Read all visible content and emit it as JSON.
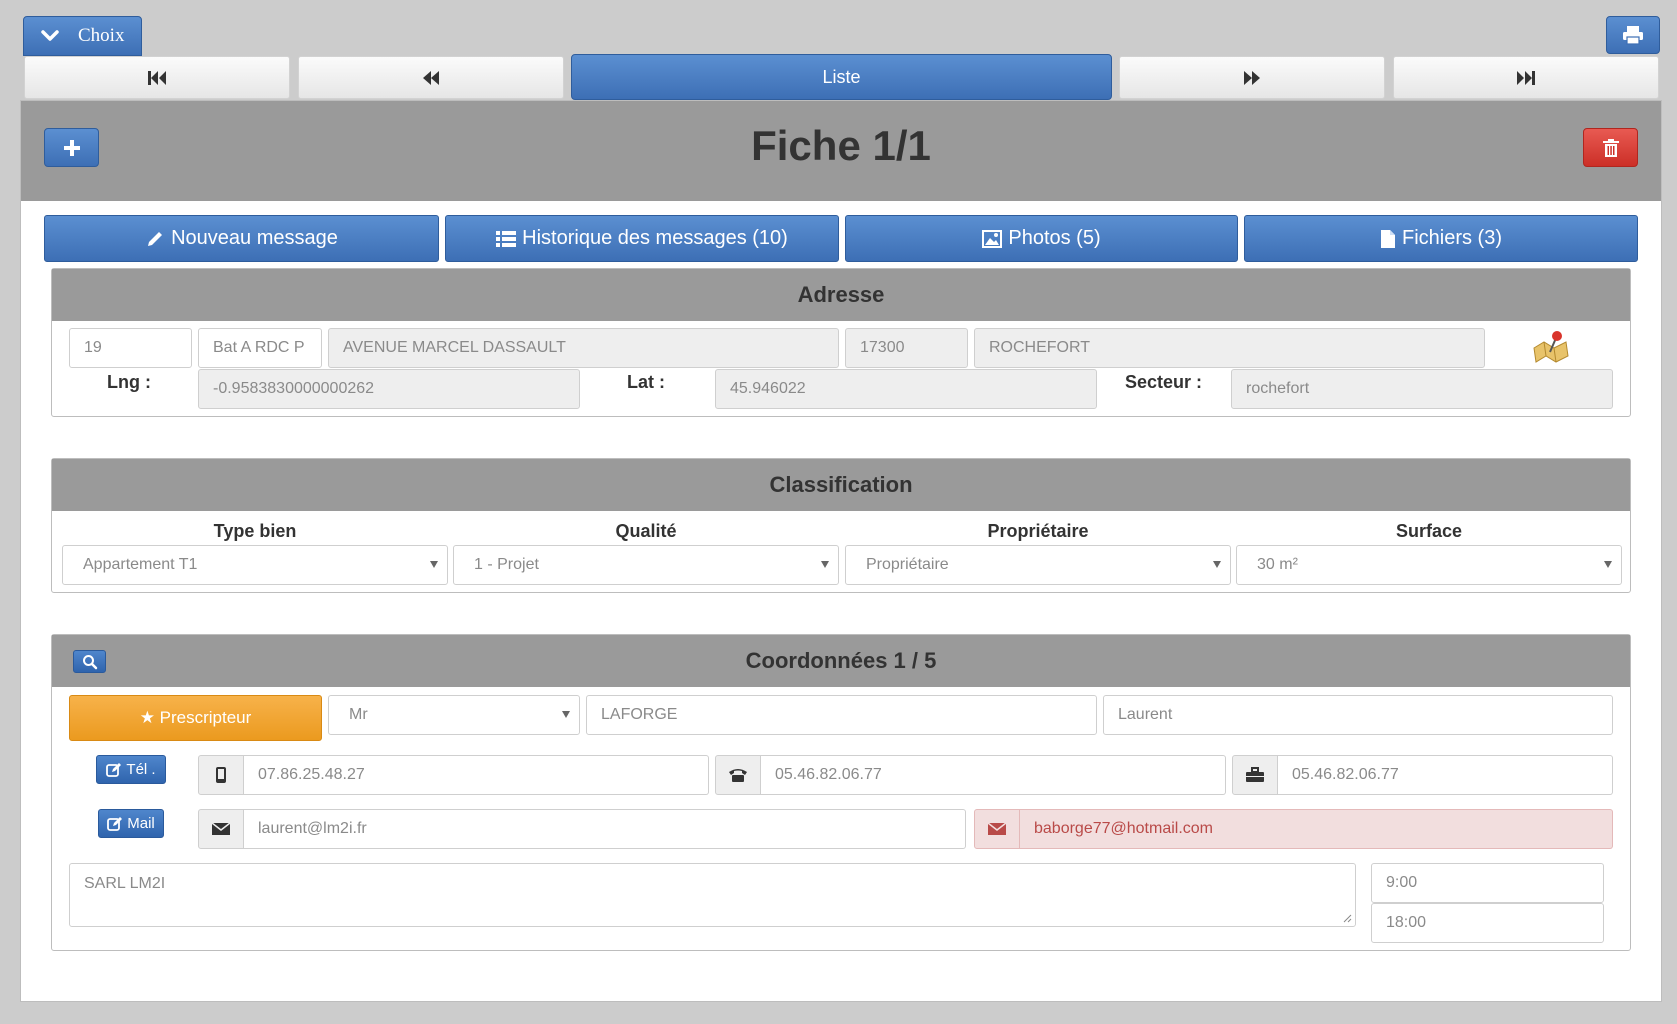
{
  "top": {
    "choix_label": "Choix",
    "liste_label": "Liste"
  },
  "fiche": {
    "title": "Fiche 1/1"
  },
  "actions": {
    "nouveau_message": "Nouveau message",
    "historique": "Historique des messages (10)",
    "photos": "Photos (5)",
    "fichiers": "Fichiers (3)"
  },
  "adresse": {
    "title": "Adresse",
    "numero": "19",
    "complement": "Bat A RDC P",
    "rue": "AVENUE MARCEL DASSAULT",
    "cp": "17300",
    "ville": "ROCHEFORT",
    "lng_label": "Lng :",
    "lng": "-0.9583830000000262",
    "lat_label": "Lat :",
    "lat": "45.946022",
    "secteur_label": "Secteur :",
    "secteur": "rochefort"
  },
  "classification": {
    "title": "Classification",
    "type_bien_label": "Type bien",
    "type_bien": "Appartement T1",
    "qualite_label": "Qualité",
    "qualite": "1 - Projet",
    "proprietaire_label": "Propriétaire",
    "proprietaire": "Propriétaire",
    "surface_label": "Surface",
    "surface": "30 m²"
  },
  "coordonnees": {
    "title": "Coordonnées 1 / 5",
    "prescripteur": "★ Prescripteur",
    "civilite": "Mr",
    "nom": "LAFORGE",
    "prenom": "Laurent",
    "tel_label": "Tél .",
    "tel_mobile": "07.86.25.48.27",
    "tel_fixe": "05.46.82.06.77",
    "tel_pro": "05.46.82.06.77",
    "mail_label": "Mail",
    "mail": "laurent@lm2i.fr",
    "mail2": "baborge77@hotmail.com",
    "societe": "SARL LM2I",
    "heure_debut": "9:00",
    "heure_fin": "18:00"
  },
  "colors": {
    "primary": "#3d6fb5",
    "danger": "#cc2f27",
    "warning": "#eb9a1f",
    "header_gray": "#9a9a9a"
  }
}
